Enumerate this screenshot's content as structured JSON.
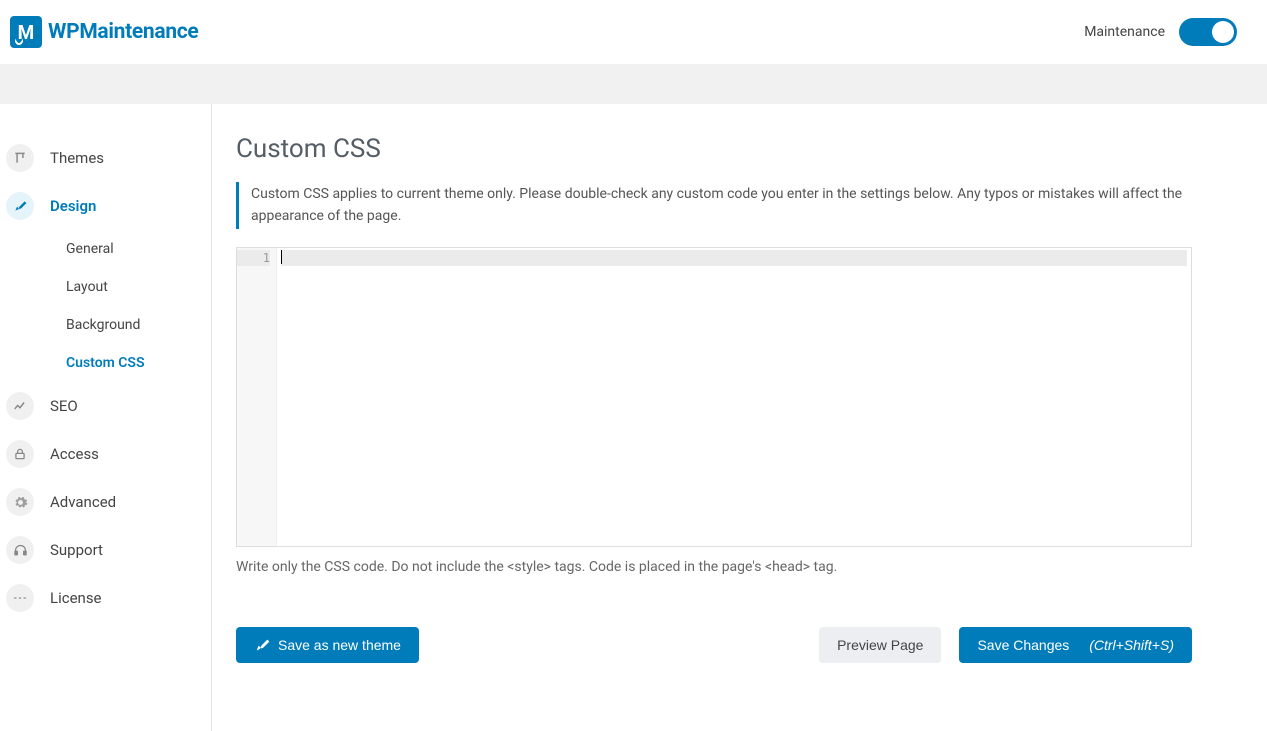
{
  "brand": {
    "mark": "M",
    "wp": "WP",
    "maintenance": "Maintenance"
  },
  "header": {
    "maintenance_label": "Maintenance"
  },
  "sidebar": {
    "items": [
      {
        "label": "Themes"
      },
      {
        "label": "Design"
      },
      {
        "label": "SEO"
      },
      {
        "label": "Access"
      },
      {
        "label": "Advanced"
      },
      {
        "label": "Support"
      },
      {
        "label": "License"
      }
    ],
    "design_sub": [
      {
        "label": "General"
      },
      {
        "label": "Layout"
      },
      {
        "label": "Background"
      },
      {
        "label": "Custom CSS"
      }
    ]
  },
  "page": {
    "title": "Custom CSS",
    "notice": "Custom CSS applies to current theme only. Please double-check any custom code you enter in the settings below. Any typos or mistakes will affect the appearance of the page.",
    "editor": {
      "line_numbers": [
        "1"
      ],
      "content": ""
    },
    "helper": "Write only the CSS code. Do not include the <style> tags. Code is placed in the page's <head> tag.",
    "buttons": {
      "save_theme": "Save as new theme",
      "preview": "Preview Page",
      "save_changes": "Save Changes",
      "save_shortcut": "(Ctrl+Shift+S)"
    }
  }
}
